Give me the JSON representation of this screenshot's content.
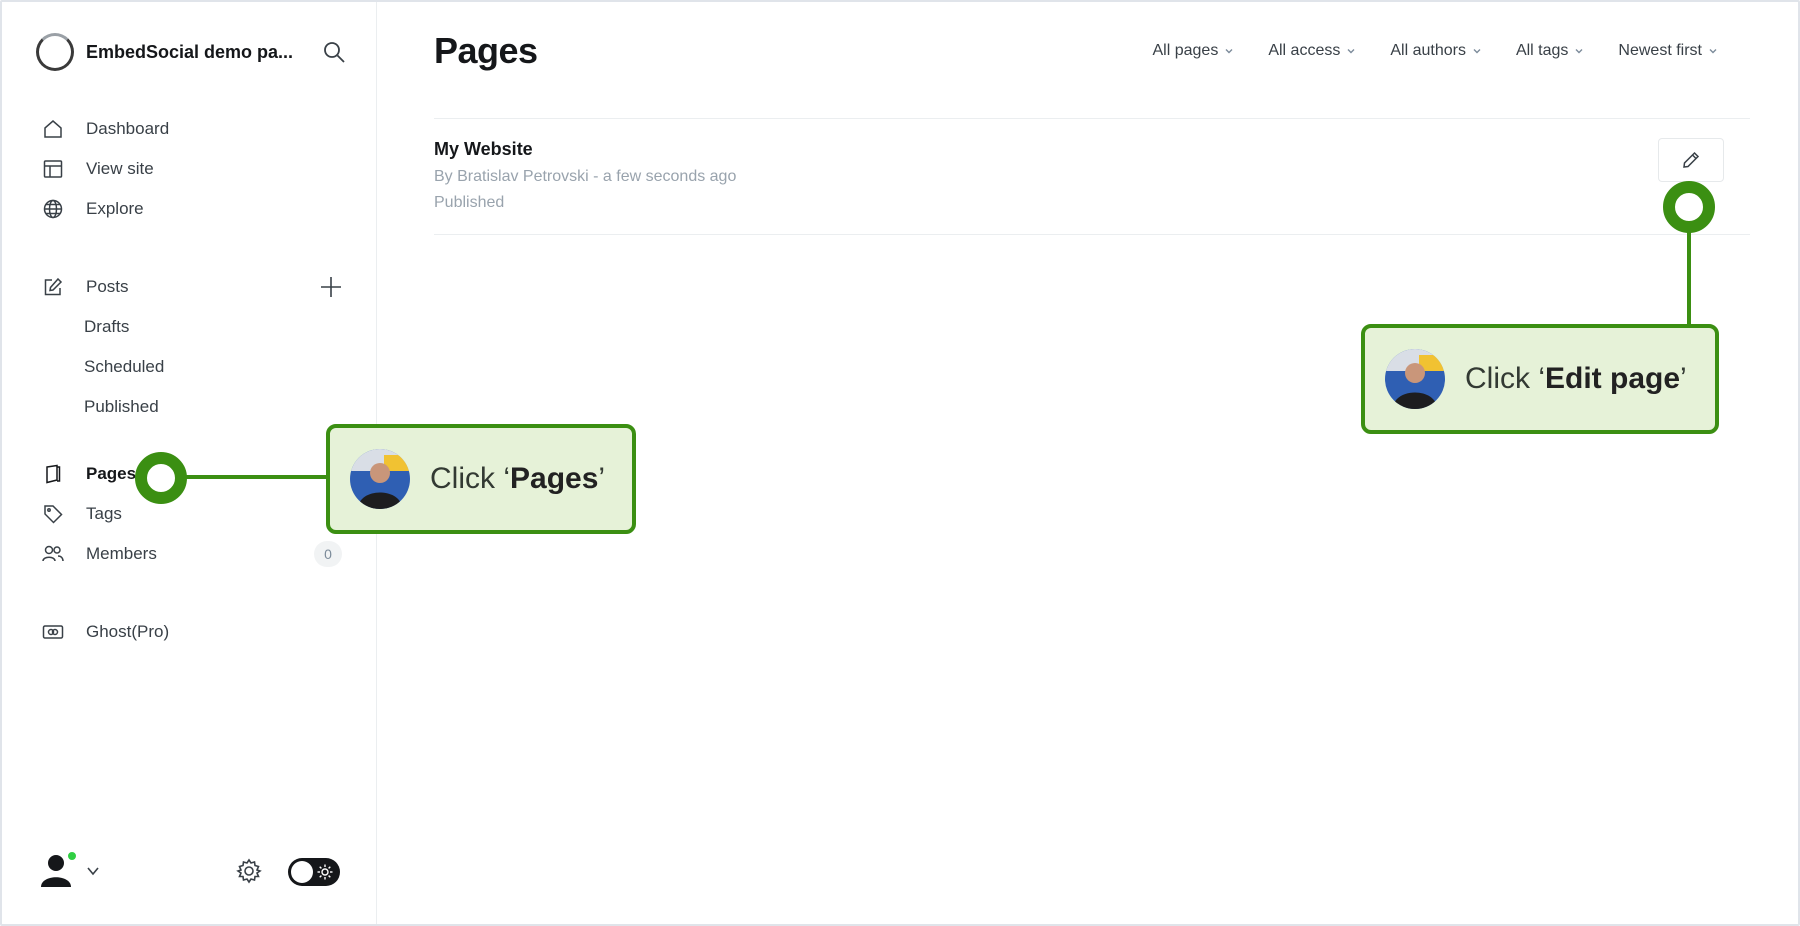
{
  "sidebar": {
    "site_name": "EmbedSocial demo pa...",
    "nav_primary": [
      {
        "label": "Dashboard",
        "icon": "home-icon"
      },
      {
        "label": "View site",
        "icon": "layout-icon"
      },
      {
        "label": "Explore",
        "icon": "globe-icon"
      }
    ],
    "posts": {
      "label": "Posts",
      "icon": "edit-icon"
    },
    "post_subitems": [
      "Drafts",
      "Scheduled",
      "Published"
    ],
    "nav_secondary": [
      {
        "label": "Pages",
        "icon": "page-icon",
        "active": true
      },
      {
        "label": "Tags",
        "icon": "tag-icon"
      },
      {
        "label": "Members",
        "icon": "members-icon",
        "badge": "0"
      }
    ],
    "ghost_pro": {
      "label": "Ghost(Pro)",
      "icon": "ghost-pro-icon"
    }
  },
  "main": {
    "title": "Pages",
    "filters": [
      "All pages",
      "All access",
      "All authors",
      "All tags",
      "Newest first"
    ],
    "rows": [
      {
        "title": "My Website",
        "meta": "By Bratislav Petrovski - a few seconds ago",
        "status": "Published"
      }
    ]
  },
  "callouts": {
    "pages": {
      "prefix": "Click ‘",
      "strong": "Pages",
      "suffix": "’"
    },
    "edit": {
      "prefix": "Click ‘",
      "strong": "Edit page",
      "suffix": "’"
    }
  },
  "colors": {
    "accent_green": "#3b8f12",
    "callout_bg": "#e6f2d8",
    "online": "#30cf43"
  }
}
